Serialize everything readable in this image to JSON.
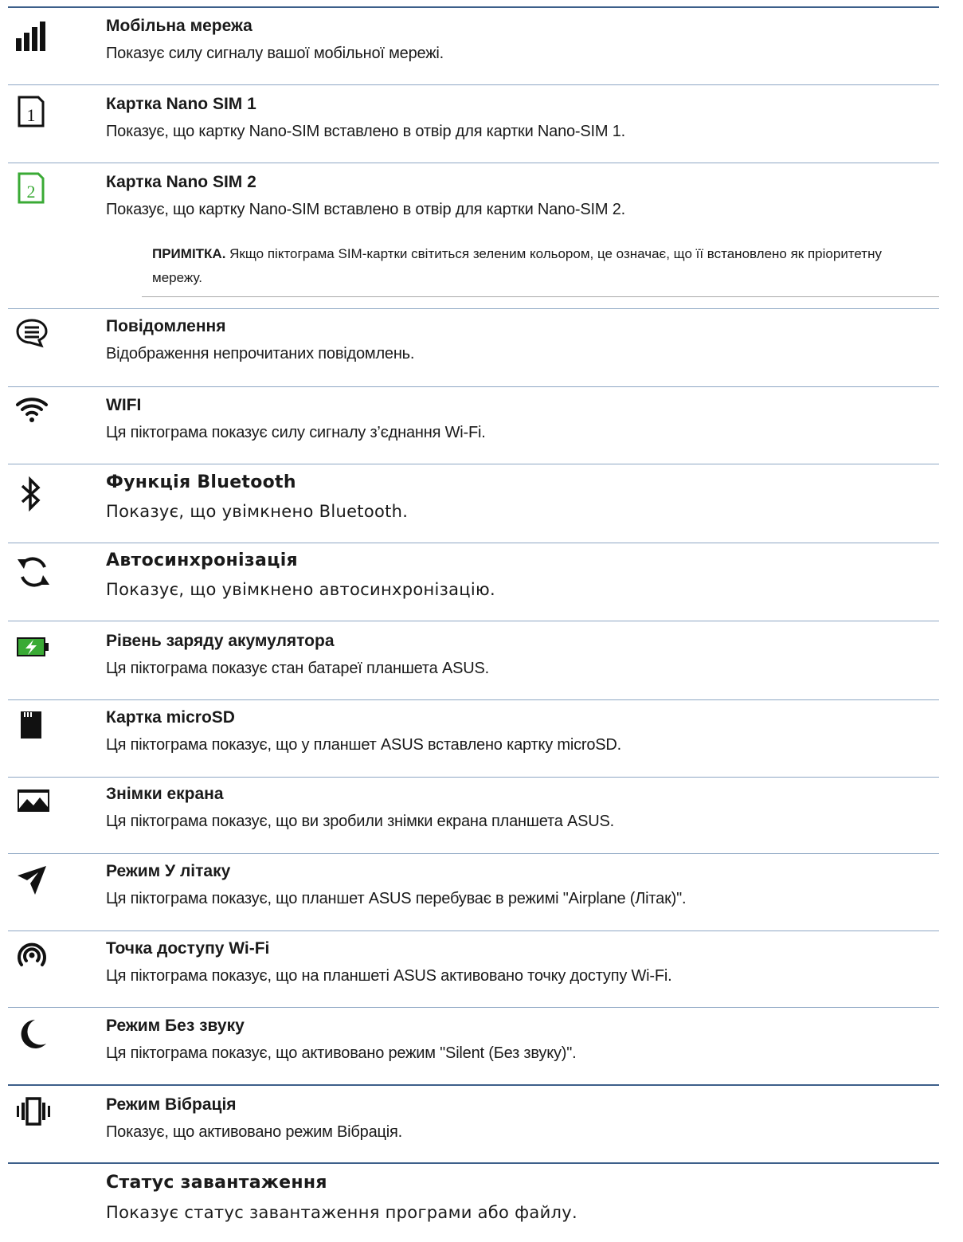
{
  "items": [
    {
      "icon": "signal-bars-icon",
      "title": "Мобільна мережа",
      "desc": "Показує силу сигналу вашої мобільної мережі."
    },
    {
      "icon": "sim-card-1-icon",
      "title": "Картка Nano SIM 1",
      "desc": "Показує, що картку Nano-SIM вставлено в отвір для картки Nano-SIM 1."
    },
    {
      "icon": "sim-card-2-icon",
      "title": "Картка Nano SIM 2",
      "desc": "Показує, що картку Nano-SIM вставлено в отвір для картки Nano-SIM 2."
    },
    {
      "icon": "message-bubble-icon",
      "title": "Повідомлення",
      "desc": "Відображення непрочитаних повідомлень."
    },
    {
      "icon": "wifi-icon",
      "title": "WIFI",
      "desc": "Ця піктограма показує силу сигналу з’єднання Wi-Fi."
    },
    {
      "icon": "bluetooth-icon",
      "title": "Функція Bluetooth",
      "desc": "Показує, що увімкнено Bluetooth."
    },
    {
      "icon": "sync-icon",
      "title": "Автосинхронізація",
      "desc": "Показує, що увімкнено автосинхронізацію."
    },
    {
      "icon": "battery-charging-icon",
      "title": "Рівень заряду акумулятора",
      "desc": "Ця піктограма показує стан батареї планшета ASUS."
    },
    {
      "icon": "microsd-card-icon",
      "title": "Картка microSD",
      "desc": "Ця піктограма показує, що у планшет ASUS вставлено картку microSD."
    },
    {
      "icon": "screenshot-image-icon",
      "title": "Знімки екрана",
      "desc": "Ця піктограма показує, що ви зробили знімки екрана планшета ASUS."
    },
    {
      "icon": "airplane-icon",
      "title": "Режим У літаку",
      "desc": "Ця піктограма показує, що планшет ASUS перебуває в режимі \"Airplane (Літак)\"."
    },
    {
      "icon": "hotspot-icon",
      "title": "Точка доступу Wi-Fi",
      "desc": "Ця піктограма показує, що на планшеті ASUS активовано точку доступу Wi-Fi."
    },
    {
      "icon": "moon-icon",
      "title": "Режим Без звуку",
      "desc": "Ця піктограма показує, що активовано режим \"Silent (Без звуку)\"."
    },
    {
      "icon": "vibrate-icon",
      "title": "Режим Вібрація",
      "desc": "Показує, що активовано режим Вібрація."
    },
    {
      "icon": "",
      "title": "Статус завантаження",
      "desc": "Показує статус завантаження програми або файлу."
    }
  ],
  "note": {
    "label": "ПРИМІТКА.",
    "text": "Якщо піктограма SIM-картки світиться зеленим кольором, це означає, що її встановлено як пріоритетну мережу."
  },
  "colors": {
    "rule": "#8ea7c4",
    "rule_strong": "#3d5f8a",
    "sim2_green": "#3aaa35",
    "battery_green": "#3aaa35"
  }
}
